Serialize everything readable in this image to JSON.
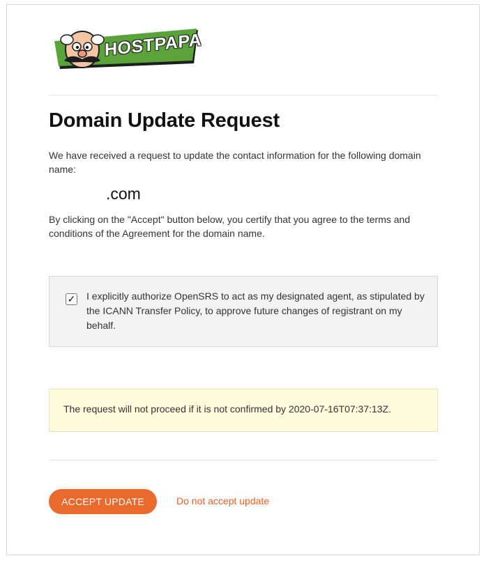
{
  "logo": {
    "text": "HOSTPAPA",
    "icon": "hostpapa-mascot-logo"
  },
  "page": {
    "title": "Domain Update Request",
    "intro": "We have received a request to update the contact information for the following domain name:",
    "domain_suffix": ".com",
    "certify": "By clicking on the \"Accept\" button below, you certify that you agree to the terms and conditions of the Agreement for the domain name."
  },
  "authorization": {
    "checked": true,
    "check_mark": "✓",
    "text": "I explicitly authorize OpenSRS to act as my designated agent, as stipulated by the ICANN Transfer Policy, to approve future changes of registrant on my behalf."
  },
  "notice": {
    "text": "The request will not proceed if it is not confirmed by 2020-07-16T07:37:13Z."
  },
  "actions": {
    "accept_label": "ACCEPT UPDATE",
    "decline_label": "Do not accept update"
  },
  "colors": {
    "accent": "#ea6a2c",
    "logo_green": "#5aa33a",
    "notice_bg": "#fefcdc",
    "auth_bg": "#f3f3f3"
  }
}
